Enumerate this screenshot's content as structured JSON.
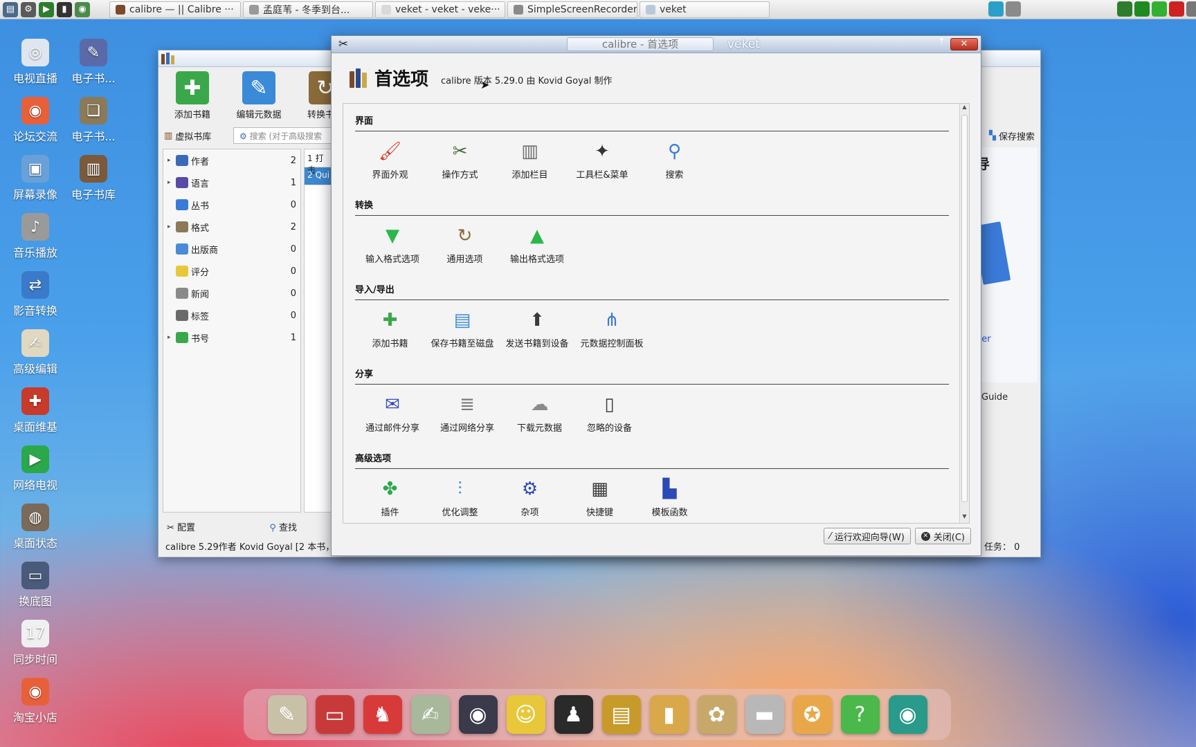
{
  "taskbar": {
    "launchers": [
      {
        "name": "system-monitor-icon",
        "glyph": "▤",
        "color": "#4a6a8a"
      },
      {
        "name": "settings-gear-icon",
        "glyph": "⚙",
        "color": "#5a5a5a"
      },
      {
        "name": "play-icon",
        "glyph": "▶",
        "color": "#2d7d2d"
      },
      {
        "name": "terminal-icon",
        "glyph": "▮",
        "color": "#333333"
      },
      {
        "name": "globe-icon",
        "glyph": "◉",
        "color": "#4a8a4a"
      }
    ],
    "tasks": [
      {
        "label": "calibre — || Calibre ···",
        "color": "#7a4a2a",
        "width": 198
      },
      {
        "label": "孟庭苇 - 冬季到台...",
        "color": "#9a9a9a",
        "width": 196
      },
      {
        "label": "veket - veket - veke···",
        "color": "#d9d9d9",
        "width": 196
      },
      {
        "label": "SimpleScreenRecorder",
        "color": "#8a8a8a",
        "width": 196
      },
      {
        "label": "veket",
        "color": "#b9c9da",
        "width": 196
      }
    ],
    "tray_left": [
      {
        "name": "network-icon",
        "color": "#2aa0c8"
      },
      {
        "name": "windows-icon",
        "color": "#8a8a8a"
      }
    ],
    "tray_right": [
      {
        "name": "media-icon",
        "color": "#2d7d2d"
      },
      {
        "name": "cpu-monitor-icon",
        "color": "#1f8a1f"
      },
      {
        "name": "battery-icon",
        "color": "#33b033"
      },
      {
        "name": "record-icon",
        "color": "#cc2222"
      },
      {
        "name": "volume-icon",
        "color": "#777777"
      }
    ]
  },
  "desktop_icons": [
    {
      "name": "tv-live-icon",
      "label": "电视直播",
      "glyph": "◎",
      "color": "#dfe6f0",
      "col": 0,
      "row": 0
    },
    {
      "name": "ebook-1-icon",
      "label": "电子书...",
      "glyph": "✎",
      "color": "#5a6aa8",
      "col": 1,
      "row": 0
    },
    {
      "name": "forum-icon",
      "label": "论坛交流",
      "glyph": "◉",
      "color": "#e8603a",
      "col": 0,
      "row": 1
    },
    {
      "name": "ebook-2-icon",
      "label": "电子书...",
      "glyph": "❏",
      "color": "#8a7a5a",
      "col": 1,
      "row": 1
    },
    {
      "name": "screen-record-icon",
      "label": "屏幕录像",
      "glyph": "▣",
      "color": "#6aa0d8",
      "col": 0,
      "row": 2
    },
    {
      "name": "ebook-library-icon",
      "label": "电子书库",
      "glyph": "▥",
      "color": "#7a5a3a",
      "col": 1,
      "row": 2
    },
    {
      "name": "music-player-icon",
      "label": "音乐播放",
      "glyph": "♪",
      "color": "#9a9a9a",
      "col": 0,
      "row": 3
    },
    {
      "name": "media-convert-icon",
      "label": "影音转换",
      "glyph": "⇄",
      "color": "#3a7ac8",
      "col": 0,
      "row": 4
    },
    {
      "name": "advanced-edit-icon",
      "label": "高级编辑",
      "glyph": "✍",
      "color": "#e0d8c0",
      "col": 0,
      "row": 5
    },
    {
      "name": "desktop-maintain-icon",
      "label": "桌面维基",
      "glyph": "✚",
      "color": "#c83a2a",
      "col": 0,
      "row": 6
    },
    {
      "name": "network-tv-icon",
      "label": "网络电视",
      "glyph": "▶",
      "color": "#2aa84a",
      "col": 0,
      "row": 7
    },
    {
      "name": "desktop-status-icon",
      "label": "桌面状态",
      "glyph": "◍",
      "color": "#7a6a5a",
      "col": 0,
      "row": 8
    },
    {
      "name": "change-wallpaper-icon",
      "label": "换底图",
      "glyph": "▭",
      "color": "#4a5a7a",
      "col": 0,
      "row": 9
    },
    {
      "name": "sync-time-icon",
      "label": "同步时间",
      "glyph": "17",
      "color": "#f0f0f0",
      "col": 0,
      "row": 10
    },
    {
      "name": "taobao-shop-icon",
      "label": "淘宝小店",
      "glyph": "◉",
      "color": "#e8603a",
      "col": 0,
      "row": 11
    }
  ],
  "main_window": {
    "toolbar": [
      {
        "name": "add-books-button",
        "label": "添加书籍",
        "glyph": "✚",
        "color": "#3aa84a"
      },
      {
        "name": "edit-metadata-button",
        "label": "编辑元数据",
        "glyph": "✎",
        "color": "#3a8ad8"
      },
      {
        "name": "convert-books-button",
        "label": "转换书籍",
        "glyph": "↻",
        "color": "#8a6a3a"
      }
    ],
    "virtual_library": "虚拟书库",
    "search_placeholder": "搜索 (对于高级搜索",
    "save_search": "保存搜索",
    "tag_browser": [
      {
        "name": "tag-authors",
        "label": "作者",
        "count": "2",
        "arrow": "▸",
        "color": "#3a6ab8"
      },
      {
        "name": "tag-languages",
        "label": "语言",
        "count": "1",
        "arrow": "▸",
        "color": "#5a4aa8"
      },
      {
        "name": "tag-series",
        "label": "丛书",
        "count": "0",
        "arrow": "",
        "color": "#3a7ad8"
      },
      {
        "name": "tag-formats",
        "label": "格式",
        "count": "2",
        "arrow": "▸",
        "color": "#8a7a5a"
      },
      {
        "name": "tag-publishers",
        "label": "出版商",
        "count": "0",
        "arrow": "",
        "color": "#4a8ad8"
      },
      {
        "name": "tag-rating",
        "label": "评分",
        "count": "0",
        "arrow": "",
        "color": "#e8c83a"
      },
      {
        "name": "tag-news",
        "label": "新闻",
        "count": "0",
        "arrow": "",
        "color": "#8a8a8a"
      },
      {
        "name": "tag-tags",
        "label": "标签",
        "count": "0",
        "arrow": "",
        "color": "#6a6a6a"
      },
      {
        "name": "tag-identifiers",
        "label": "书号",
        "count": "1",
        "arrow": "▸",
        "color": "#3aa84a"
      }
    ],
    "configure": "配置",
    "find": "查找",
    "status": "calibre 5.29作者 Kovid Goyal   [2 本书，",
    "book_rows": [
      {
        "num": "1",
        "text": "打击"
      },
      {
        "num": "2",
        "text": "Qui"
      }
    ],
    "right_fragments": {
      "heading": "导",
      "link": "per",
      "guide": "Guide",
      "jobs": "任务： 0"
    }
  },
  "prefs_dialog": {
    "window_title": "calibre - 首选项",
    "wm_label": "veket",
    "close_x": "✕",
    "heading": "首选项",
    "version_text": "calibre 版本 5.29.0 由 Kovid Goyal 制作",
    "sections": [
      {
        "title": "界面",
        "items": [
          {
            "name": "look-and-feel",
            "label": "界面外观",
            "glyph": "🖌",
            "color": "#d83a2a"
          },
          {
            "name": "behavior",
            "label": "操作方式",
            "glyph": "✂",
            "color": "#4a6a3a"
          },
          {
            "name": "add-columns",
            "label": "添加栏目",
            "glyph": "▥",
            "color": "#6a6a6a"
          },
          {
            "name": "toolbars-menus",
            "label": "工具栏&菜单",
            "glyph": "✦",
            "color": "#333333"
          },
          {
            "name": "searching",
            "label": "搜索",
            "glyph": "⚲",
            "color": "#3a7ad8"
          }
        ]
      },
      {
        "title": "转换",
        "items": [
          {
            "name": "input-options",
            "label": "输入格式选项",
            "glyph": "▼",
            "color": "#2ab84a"
          },
          {
            "name": "common-options",
            "label": "通用选项",
            "glyph": "↻",
            "color": "#8a6a3a"
          },
          {
            "name": "output-options",
            "label": "输出格式选项",
            "glyph": "▲",
            "color": "#2ab84a"
          }
        ]
      },
      {
        "title": "导入/导出",
        "items": [
          {
            "name": "adding-books",
            "label": "添加书籍",
            "glyph": "✚",
            "color": "#3aa84a"
          },
          {
            "name": "saving-to-disk",
            "label": "保存书籍至磁盘",
            "glyph": "▤",
            "color": "#3a8ad8"
          },
          {
            "name": "sending-to-device",
            "label": "发送书籍到设备",
            "glyph": "⬆",
            "color": "#3a3a3a"
          },
          {
            "name": "metadata-plugboards",
            "label": "元数据控制面板",
            "glyph": "⋔",
            "color": "#3a7ad8"
          }
        ]
      },
      {
        "title": "分享",
        "items": [
          {
            "name": "sharing-email",
            "label": "通过邮件分享",
            "glyph": "✉",
            "color": "#3a4ab8"
          },
          {
            "name": "sharing-net",
            "label": "通过网络分享",
            "glyph": "≣",
            "color": "#7a7a7a"
          },
          {
            "name": "metadata-download",
            "label": "下载元数据",
            "glyph": "☁",
            "color": "#8a8a8a"
          },
          {
            "name": "ignored-devices",
            "label": "忽略的设备",
            "glyph": "▯",
            "color": "#3a3a3a"
          }
        ]
      },
      {
        "title": "高级选项",
        "items": [
          {
            "name": "plugins",
            "label": "插件",
            "glyph": "✤",
            "color": "#2aa84a"
          },
          {
            "name": "tweaks",
            "label": "优化调整",
            "glyph": "⫶",
            "color": "#3a8ad8"
          },
          {
            "name": "miscellaneous",
            "label": "杂项",
            "glyph": "⚙",
            "color": "#2a4ab8"
          },
          {
            "name": "shortcuts",
            "label": "快捷键",
            "glyph": "▦",
            "color": "#3a3a3a"
          },
          {
            "name": "template-functions",
            "label": "模板函数",
            "glyph": "▙",
            "color": "#2a4ab8"
          }
        ]
      }
    ],
    "wizard_button": "运行欢迎向导(W)",
    "close_button": "关闭(C)"
  },
  "dock": [
    {
      "name": "dock-files-icon",
      "glyph": "✎",
      "color": "#c9c0a8"
    },
    {
      "name": "dock-monitor-icon",
      "glyph": "▭",
      "color": "#c83a3a"
    },
    {
      "name": "dock-pet-icon",
      "glyph": "♞",
      "color": "#d83a3a"
    },
    {
      "name": "dock-editor-icon",
      "glyph": "✍",
      "color": "#a8b89a"
    },
    {
      "name": "dock-media-icon",
      "glyph": "◉",
      "color": "#3a3a4a"
    },
    {
      "name": "dock-chat-icon",
      "glyph": "☺",
      "color": "#e8c83a"
    },
    {
      "name": "dock-qq-icon",
      "glyph": "♟",
      "color": "#2a2a2a"
    },
    {
      "name": "dock-notebook-icon",
      "glyph": "▤",
      "color": "#c89a2a"
    },
    {
      "name": "dock-chart-icon",
      "glyph": "▮",
      "color": "#d8a84a"
    },
    {
      "name": "dock-paint-icon",
      "glyph": "✿",
      "color": "#c8a86a"
    },
    {
      "name": "dock-usb-icon",
      "glyph": "▬",
      "color": "#b8b8b8"
    },
    {
      "name": "dock-veket-icon",
      "glyph": "✪",
      "color": "#e8a84a"
    },
    {
      "name": "dock-help-icon",
      "glyph": "?",
      "color": "#4ab84a"
    },
    {
      "name": "dock-camera-icon",
      "glyph": "◉",
      "color": "#2a9a8a"
    }
  ]
}
